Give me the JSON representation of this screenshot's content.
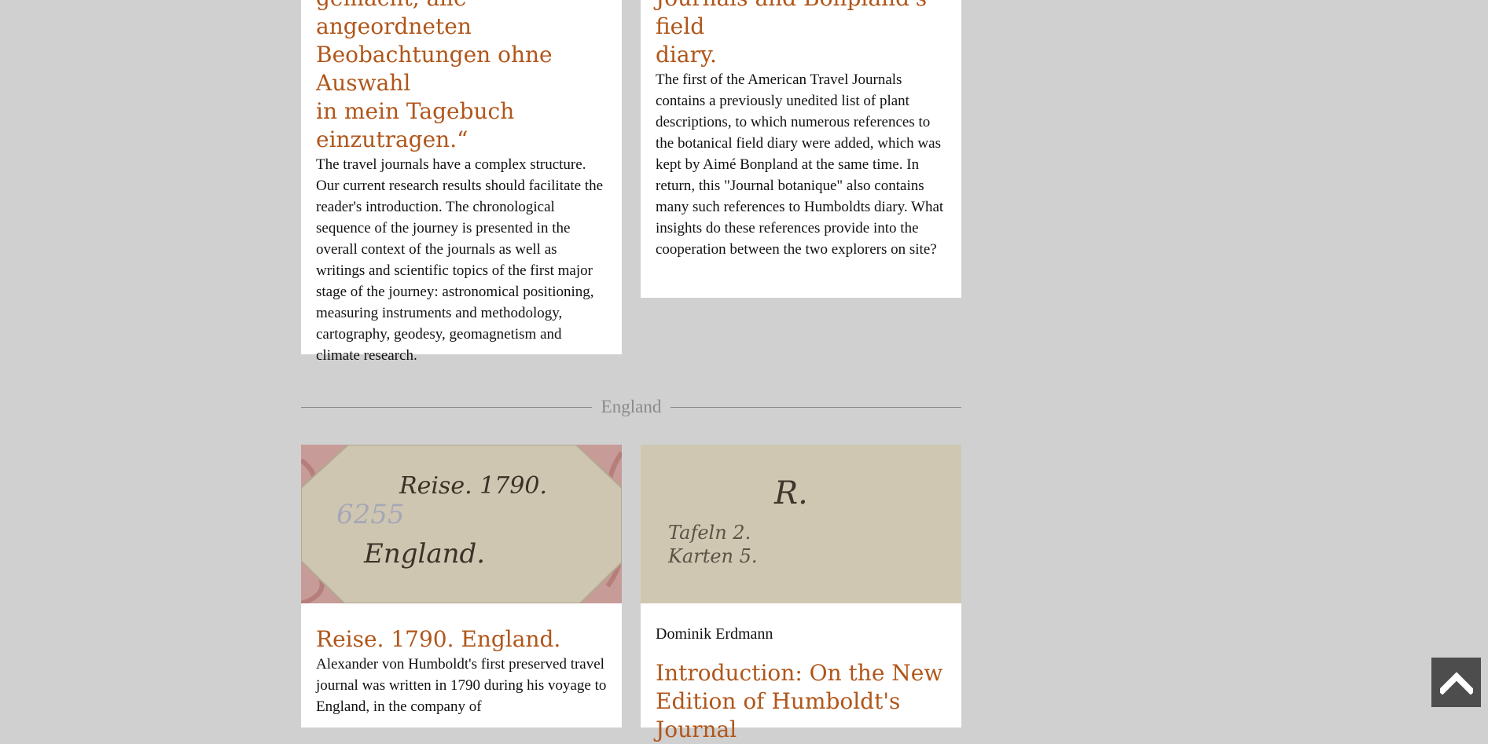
{
  "cards_top": [
    {
      "title_lines": [
        "gemacht, alle angeordneten",
        "Beobachtungen ohne Auswahl",
        "in mein Tagebuch",
        "einzutragen.“"
      ],
      "body": "The travel journals have a complex structure. Our current research results should facilitate the reader's introduction. The chronological sequence of the journey is presented in the overall context of the journals as well as writings and scientific topics of the first major stage of the journey: astronomical positioning, measuring instruments and methodology, cartography, geodesy, geomagnetism and climate research."
    },
    {
      "title_lines": [
        "Journals and Bonpland's field",
        "diary."
      ],
      "body": "The first of the American Travel Journals contains a previously unedited list of plant descriptions, to which numerous references to the botanical field diary were added, which was kept by Aimé Bonpland at the same time. In return, this \"Journal botanique\" also contains many such references to Humboldts diary. What insights do these references provide into the cooperation between the two explorers on site?"
    }
  ],
  "section": {
    "label": "England"
  },
  "cards_bottom": [
    {
      "image_text": [
        "Reise. 1790.",
        "6255",
        "England."
      ],
      "title": "Reise. 1790. England.",
      "body": "Alexander von Humboldt's first preserved travel journal was written in 1790 during his voyage to England, in the company of"
    },
    {
      "image_text": [
        "R.",
        "Tafeln 2.",
        "Karten 5."
      ],
      "author": "Dominik Erdmann",
      "title_lines": [
        "Introduction: On the New",
        "Edition of Humboldt's Journal"
      ]
    }
  ],
  "back_to_top": {
    "icon": "chevron-up-icon"
  },
  "colors": {
    "background": "#d0d0d0",
    "accent": "#b0561a",
    "card": "#ffffff"
  }
}
